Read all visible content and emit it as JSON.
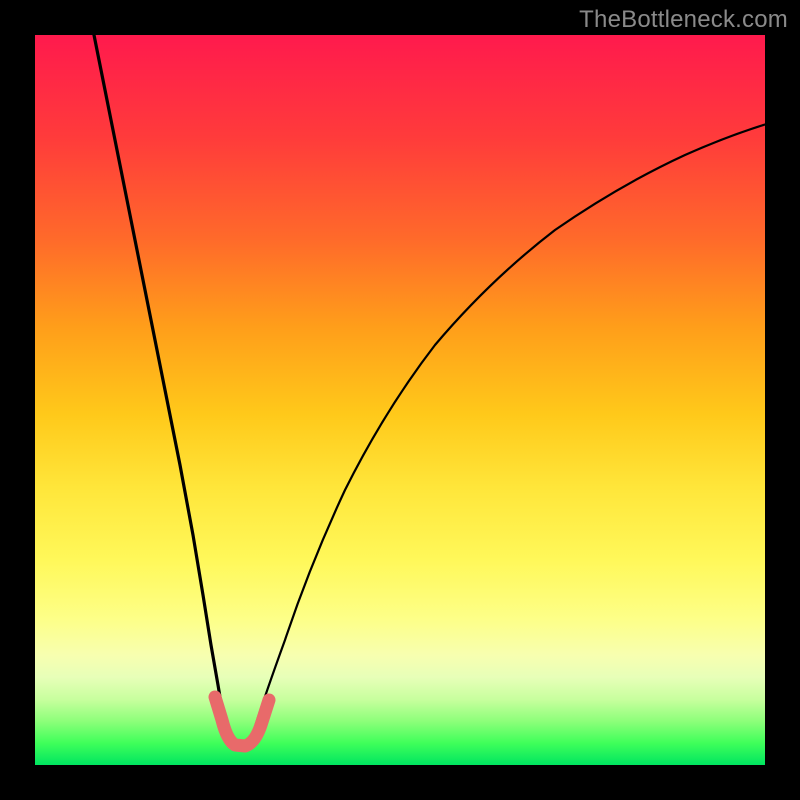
{
  "watermark": "TheBottleneck.com",
  "colors": {
    "background_frame": "#000000",
    "curve": "#000000",
    "highlight_segment": "#e86a6a",
    "gradient_top": "#ff1a4d",
    "gradient_bottom": "#00e560"
  },
  "chart_data": {
    "type": "line",
    "title": "",
    "xlabel": "",
    "ylabel": "",
    "xlim": [
      0,
      100
    ],
    "ylim": [
      0,
      100
    ],
    "grid": false,
    "legend": false,
    "annotations": [
      "TheBottleneck.com"
    ],
    "series": [
      {
        "name": "bottleneck-curve",
        "x_estimated_pct": [
          8,
          10,
          12,
          14,
          16,
          18,
          20,
          22,
          24,
          25.5,
          27,
          30,
          35,
          40,
          45,
          50,
          55,
          60,
          65,
          70,
          75,
          80,
          85,
          90,
          95,
          100
        ],
        "y_estimated_pct": [
          100,
          88,
          76,
          64,
          52,
          40,
          28,
          16,
          8,
          3,
          3,
          8,
          18,
          28,
          36,
          43,
          50,
          56,
          61,
          66,
          70,
          74,
          77,
          80,
          83,
          85
        ],
        "note": "Values are estimated from pixel positions; curve resembles |x - x_min| shaped bottleneck with minimum near x≈26%, y≈3%."
      },
      {
        "name": "highlighted-optimum-region",
        "x_estimated_pct": [
          23,
          24,
          25,
          26,
          27,
          28,
          29,
          30
        ],
        "y_estimated_pct": [
          8,
          5,
          3.5,
          3,
          3,
          3.5,
          5,
          7
        ],
        "note": "Thick pink/salmon overlay segment marking the trough of the curve."
      }
    ],
    "background": {
      "type": "vertical-gradient",
      "stops_pct_from_top": [
        {
          "pct": 0,
          "color": "#ff1a4d"
        },
        {
          "pct": 50,
          "color": "#ffc91a"
        },
        {
          "pct": 80,
          "color": "#fdff88"
        },
        {
          "pct": 100,
          "color": "#00e560"
        }
      ],
      "meaning": "Heat-gradient backdrop; red=high bottleneck, green=low bottleneck."
    }
  }
}
